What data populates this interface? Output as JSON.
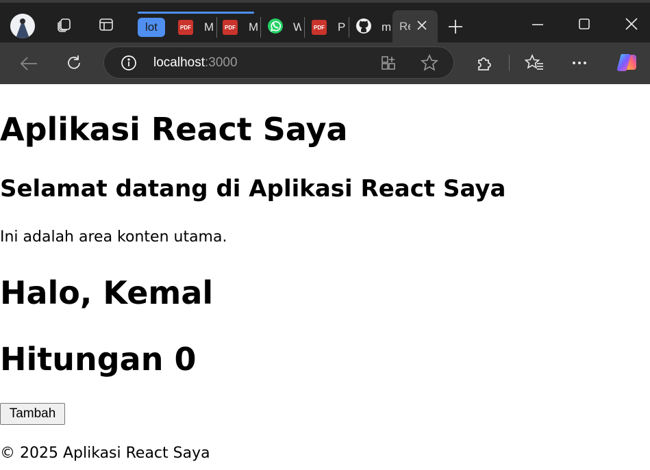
{
  "browser": {
    "tabs": [
      {
        "title": "lot",
        "icon": "tab-group"
      },
      {
        "title": "M",
        "icon": "pdf-icon"
      },
      {
        "title": "M",
        "icon": "pdf-icon"
      },
      {
        "title": "W",
        "icon": "whatsapp-icon"
      },
      {
        "title": "P",
        "icon": "pdf-icon"
      },
      {
        "title": "m",
        "icon": "github-icon"
      },
      {
        "title": "Re",
        "icon": "none",
        "active": true
      }
    ],
    "pdf_label": "PDF",
    "address": {
      "host": "localhost",
      "port": ":3000"
    }
  },
  "page": {
    "title": "Aplikasi React Saya",
    "welcome": "Selamat datang di Aplikasi React Saya",
    "paragraph": "Ini adalah area konten utama.",
    "greeting": "Halo, Kemal",
    "counter": "Hitungan 0",
    "button_label": "Tambah",
    "footer": "© 2025 Aplikasi React Saya"
  },
  "colors": {
    "tab_group_accent": "#4f8ff0",
    "pdf_red": "#c9342c",
    "whatsapp_green": "#25d366"
  }
}
